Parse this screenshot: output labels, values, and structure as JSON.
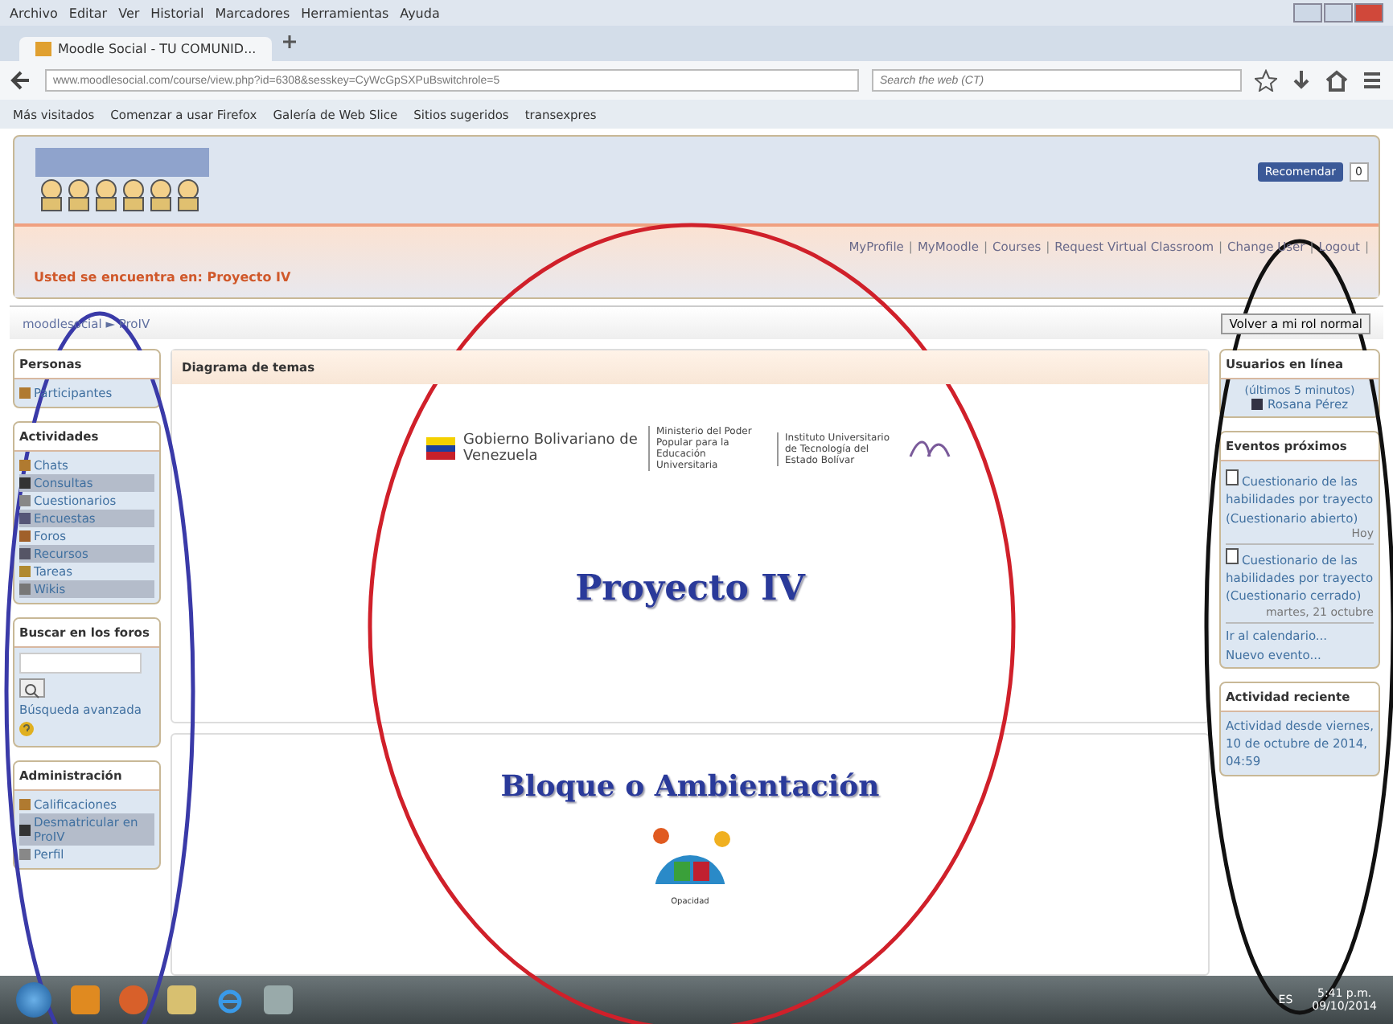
{
  "menu_bar": [
    "Archivo",
    "Editar",
    "Ver",
    "Historial",
    "Marcadores",
    "Herramientas",
    "Ayuda"
  ],
  "tabs": [
    {
      "label": "Moodle Social - TU COMUNID...",
      "selected": true
    }
  ],
  "address_bar": {
    "value": "www.moodlesocial.com/course/view.php?id=6308&sesskey=CyWcGpSXPuBswitchrole=5"
  },
  "search": {
    "placeholder": "Search the web (CT)"
  },
  "bookmarks": [
    "Más visitados",
    "Comenzar a usar Firefox",
    "Galería de Web Slice",
    "Sitios sugeridos",
    "transexpres"
  ],
  "header": {
    "like_button": "Recomendar",
    "like_count": "0",
    "breadcrumb_notice": "Usted se encuentra en: Proyecto IV",
    "links": [
      "MyProfile",
      "MyMoodle",
      "Courses",
      "Request Virtual Classroom",
      "Change User",
      "Logout"
    ],
    "separator": "|"
  },
  "navbar": {
    "path": "moodlesocial ► ProIV",
    "button": "Volver a mi rol normal"
  },
  "left_blocks": [
    {
      "title": "Personas",
      "items": [
        {
          "label": "Participantes",
          "shaded": false
        }
      ]
    },
    {
      "title": "Actividades",
      "items": [
        {
          "label": "Chats",
          "shaded": false
        },
        {
          "label": "Consultas",
          "shaded": true
        },
        {
          "label": "Cuestionarios",
          "shaded": false
        },
        {
          "label": "Encuestas",
          "shaded": true
        },
        {
          "label": "Foros",
          "shaded": false
        },
        {
          "label": "Recursos",
          "shaded": true
        },
        {
          "label": "Tareas",
          "shaded": false
        },
        {
          "label": "Wikis",
          "shaded": true
        }
      ]
    },
    {
      "title": "Administración",
      "items": [
        {
          "label": "Calificaciones",
          "shaded": false
        },
        {
          "label": "Desmatricular en ProIV",
          "shaded": true
        },
        {
          "label": "Perfil",
          "shaded": false
        }
      ]
    }
  ],
  "forum_search": {
    "title": "Buscar en los foros",
    "link": "Búsqueda avanzada"
  },
  "main": {
    "heading": "Diagrama de temas",
    "banner": [
      "Gobierno Bolivariano de Venezuela",
      "Ministerio del Poder Popular para la Educación Universitaria",
      "Instituto Universitario de Tecnología del Estado Bolívar"
    ],
    "title": "Proyecto IV",
    "section_title": "Bloque o Ambientación",
    "graphic_label": "Opacidad"
  },
  "online_users": {
    "title": "Usuarios en línea",
    "note": "(últimos 5 minutos)",
    "users": [
      "Rosana Pérez"
    ]
  },
  "events": {
    "title": "Eventos próximos",
    "items": [
      {
        "text": "Cuestionario de las habilidades por trayecto (Cuestionario abierto)",
        "date": "Hoy"
      },
      {
        "text": "Cuestionario de las habilidades por trayecto (Cuestionario cerrado)",
        "date": "martes, 21 octubre"
      }
    ],
    "links": [
      "Ir al calendario...",
      "Nuevo evento..."
    ]
  },
  "recent": {
    "title": "Actividad reciente",
    "text": "Actividad desde viernes, 10 de octubre de 2014, 04:59"
  },
  "taskbar": {
    "language": "ES",
    "time": "5:41 p.m.",
    "date": "09/10/2014"
  },
  "annotations": [
    {
      "color": "#3a3aa8"
    },
    {
      "color": "#d0202a"
    },
    {
      "color": "#111111"
    }
  ]
}
